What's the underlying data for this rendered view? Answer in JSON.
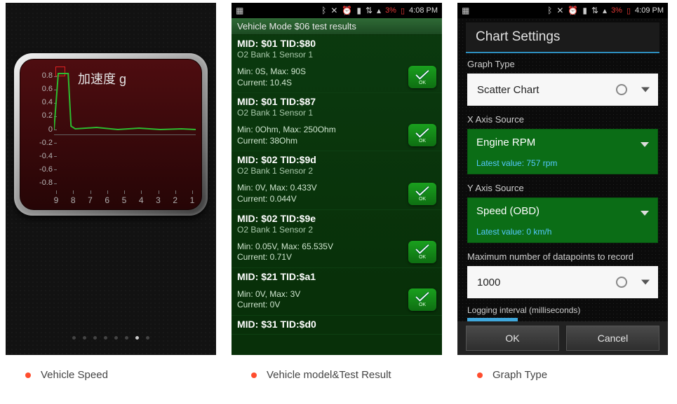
{
  "status_bar": {
    "time": "4:08 PM",
    "time3": "4:09 PM",
    "battery_pct": "3%",
    "icons": [
      "bluetooth",
      "mute",
      "alarm",
      "signal",
      "wifi",
      "data"
    ]
  },
  "panel1": {
    "title": "加速度 g",
    "y_ticks": [
      "0.8",
      "0.6",
      "0.4",
      "0.2",
      "0",
      "-0.2",
      "-0.4",
      "-0.6",
      "-0.8"
    ],
    "x_ticks": [
      "9",
      "8",
      "7",
      "6",
      "5",
      "4",
      "3",
      "2",
      "1"
    ]
  },
  "chart_data": {
    "type": "line",
    "title": "加速度 g",
    "xlabel": "",
    "ylabel": "",
    "ylim": [
      -0.8,
      0.8
    ],
    "x": [
      9,
      8.8,
      8.6,
      8.4,
      8.2,
      8,
      7,
      6,
      5,
      4,
      3,
      2,
      1
    ],
    "values": [
      0.0,
      0.82,
      0.82,
      0.82,
      0.05,
      0.0,
      0.02,
      0.0,
      0.03,
      0.0,
      0.02,
      0.0,
      0.01
    ]
  },
  "panel2": {
    "header": "Vehicle Mode $06 test results",
    "ok_label": "OK",
    "items": [
      {
        "mid": "MID: $01 TID:$80",
        "sensor": "O2 Bank 1 Sensor 1",
        "min": "Min: 0S, Max: 90S",
        "cur": "Current: 10.4S"
      },
      {
        "mid": "MID: $01 TID:$87",
        "sensor": "O2 Bank 1 Sensor 1",
        "min": "Min: 0Ohm, Max: 250Ohm",
        "cur": "Current: 38Ohm"
      },
      {
        "mid": "MID: $02 TID:$9d",
        "sensor": "O2 Bank 1 Sensor 2",
        "min": "Min: 0V, Max: 0.433V",
        "cur": "Current: 0.044V"
      },
      {
        "mid": "MID: $02 TID:$9e",
        "sensor": "O2 Bank 1 Sensor 2",
        "min": "Min: 0.05V, Max: 65.535V",
        "cur": "Current: 0.71V"
      },
      {
        "mid": "MID: $21 TID:$a1",
        "sensor": "",
        "min": "Min: 0V, Max: 3V",
        "cur": "Current: 0V"
      },
      {
        "mid": "MID: $31 TID:$d0",
        "sensor": "",
        "min": "",
        "cur": ""
      }
    ]
  },
  "panel3": {
    "title": "Chart Settings",
    "graph_type_label": "Graph Type",
    "graph_type_value": "Scatter Chart",
    "x_source_label": "X Axis Source",
    "x_source_name": "Engine RPM",
    "x_source_latest": "Latest value: 757 rpm",
    "y_source_label": "Y Axis Source",
    "y_source_name": "Speed (OBD)",
    "y_source_latest": "Latest value: 0 km/h",
    "max_points_label": "Maximum number of datapoints to record",
    "max_points_value": "1000",
    "logging_label": "Logging interval (milliseconds)",
    "ok": "OK",
    "cancel": "Cancel"
  },
  "captions": {
    "c1": "Vehicle Speed",
    "c2": "Vehicle model&Test Result",
    "c3": "Graph Type"
  }
}
